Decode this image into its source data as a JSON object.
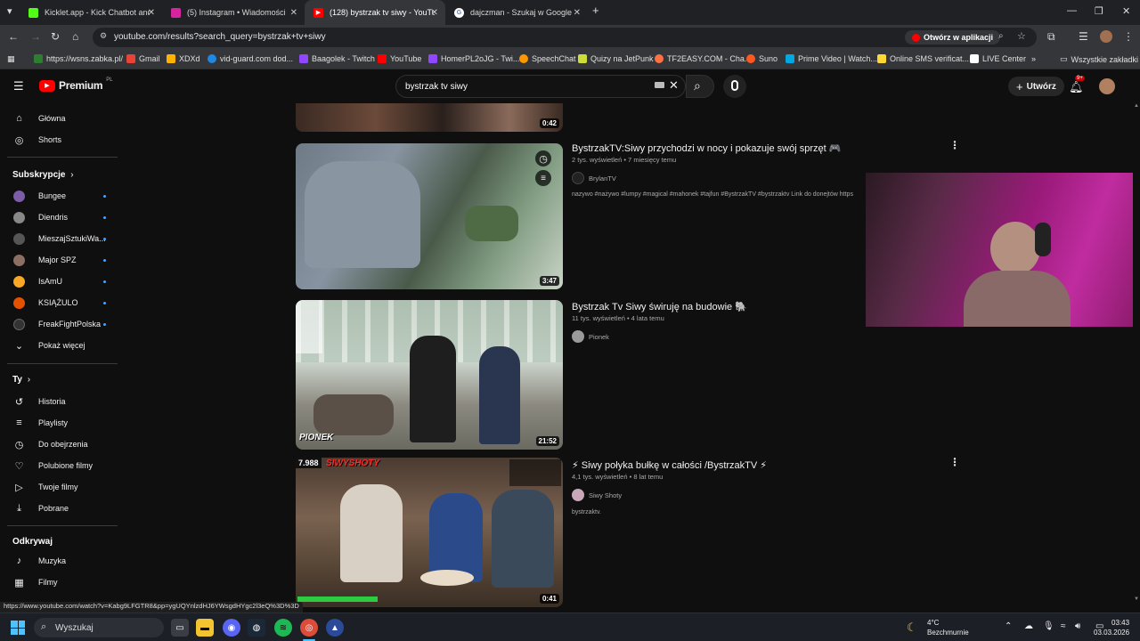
{
  "browser": {
    "tabs": [
      {
        "title": "Kicklet.app - Kick Chatbot and",
        "active": false,
        "color": "#53fc18"
      },
      {
        "title": "(5) Instagram • Wiadomości",
        "active": false,
        "color": "#d6249f"
      },
      {
        "title": "(128) bystrzak tv siwy - YouTube",
        "active": true,
        "color": "#ff0000"
      },
      {
        "title": "dajczman - Szukaj w Google",
        "active": false,
        "color": "#4285f4"
      }
    ],
    "new_tab": "+",
    "url": "youtube.com/results?search_query=bystrzak+tv+siwy",
    "open_in_app": "Otwórz w aplikacji",
    "bookmarks": [
      {
        "label": "https://wsns.zabka.pl/",
        "color": "#2e7d32"
      },
      {
        "label": "Gmail",
        "color": "#ea4335"
      },
      {
        "label": "XDXd",
        "color": "#ffb300"
      },
      {
        "label": "vid-guard.com dod...",
        "color": "#1e88e5"
      },
      {
        "label": "Baagolek - Twitch",
        "color": "#9146ff"
      },
      {
        "label": "YouTube",
        "color": "#ff0000"
      },
      {
        "label": "HomerPL2oJG - Twi...",
        "color": "#9146ff"
      },
      {
        "label": "SpeechChat",
        "color": "#ff9800"
      },
      {
        "label": "Quizy na JetPunk",
        "color": "#cddc39"
      },
      {
        "label": "TF2EASY.COM - Cha...",
        "color": "#ff7043"
      },
      {
        "label": "Suno",
        "color": "#ff5722"
      },
      {
        "label": "Prime Video | Watch...",
        "color": "#00a8e1"
      },
      {
        "label": "Online SMS verificat...",
        "color": "#fdd835"
      },
      {
        "label": "LIVE Center",
        "color": "#ffffff"
      }
    ],
    "all_bookmarks": "Wszystkie zakładki"
  },
  "yt": {
    "logo": "Premium",
    "logo_sup": "PL",
    "search_value": "bystrzak tv siwy",
    "create_label": "Utwórz",
    "notif_count": "9+"
  },
  "sidebar": {
    "main": [
      {
        "label": "Główna",
        "icon": "home-icon",
        "glyph": "⌂"
      },
      {
        "label": "Shorts",
        "icon": "shorts-icon",
        "glyph": "◎"
      }
    ],
    "subs_header": "Subskrypcje",
    "subs": [
      {
        "label": "Bungee",
        "color": "#7b5ea7"
      },
      {
        "label": "Diendris",
        "color": "#888888"
      },
      {
        "label": "MieszajSztukiWa...",
        "color": "#555555"
      },
      {
        "label": "Major SPZ",
        "color": "#8d6e63"
      },
      {
        "label": "IsAmU",
        "color": "#f9a825"
      },
      {
        "label": "KSIĄŻULO",
        "color": "#e65100"
      },
      {
        "label": "FreakFightPolska",
        "color": "#333333"
      }
    ],
    "show_more": "Pokaż więcej",
    "you_header": "Ty",
    "you": [
      {
        "label": "Historia",
        "icon": "history-icon",
        "glyph": "↺"
      },
      {
        "label": "Playlisty",
        "icon": "playlists-icon",
        "glyph": "≡"
      },
      {
        "label": "Do obejrzenia",
        "icon": "watch-later-icon",
        "glyph": "◷"
      },
      {
        "label": "Polubione filmy",
        "icon": "liked-icon",
        "glyph": "👍"
      },
      {
        "label": "Twoje filmy",
        "icon": "your-videos-icon",
        "glyph": "▶"
      },
      {
        "label": "Pobrane",
        "icon": "downloads-icon",
        "glyph": "⤓"
      }
    ],
    "explore_header": "Odkrywaj",
    "explore": [
      {
        "label": "Muzyka",
        "icon": "music-icon",
        "glyph": "♪"
      },
      {
        "label": "Filmy",
        "icon": "movies-icon",
        "glyph": "▦"
      }
    ]
  },
  "results": [
    {
      "duration": "0:42"
    },
    {
      "title": "BystrzakTV:Siwy przychodzi w nocy i pokazuje swój sprzęt 🎮",
      "meta": "2 tys. wyświetleń • 7 miesięcy temu",
      "channel": "BrylanTV",
      "desc": "nazywo #nażywo #lumpy #magical #mahonek #tajfun #BystrzakTV #bystrzaktv Link do donejtów https",
      "duration": "3:47"
    },
    {
      "title": "Bystrzak Tv Siwy świruję na budowie 🐘",
      "meta": "11 tys. wyświetleń • 4 lata temu",
      "channel": "Pionek",
      "duration": "21:52",
      "thumb_text": "PIONEK"
    },
    {
      "title": "⚡ Siwy połyka bułkę w całości /BystrzakTV ⚡",
      "meta": "4,1 tys. wyświetleń • 8 lat temu",
      "channel": "Siwy Shoty",
      "desc": "bystrzaktv.",
      "duration": "0:41",
      "thumb_text": "SIWYSHOTY",
      "thumb_num": "7.988"
    }
  ],
  "status_url": "https://www.youtube.com/watch?v=Kabg9LFGTR8&pp=ygUQYnlzdHJ6YWsgdHYgc2l3eQ%3D%3D",
  "taskbar": {
    "search_label": "Wyszukaj",
    "weather_temp": "4°C",
    "weather_desc": "Bezchmurnie",
    "time": "03:43",
    "date": "03.03.2026"
  }
}
